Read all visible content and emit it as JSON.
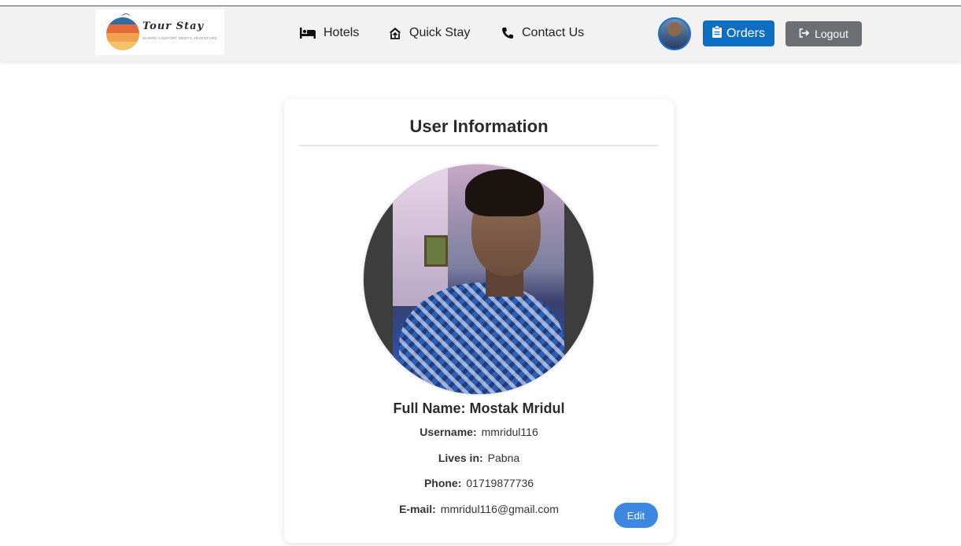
{
  "brand": {
    "name": "Tour Stay",
    "tagline": "WHERE COMFORT MEETS ADVENTURE"
  },
  "nav": {
    "links": [
      {
        "label": "Hotels",
        "icon": "bed-icon"
      },
      {
        "label": "Quick Stay",
        "icon": "house-up-icon"
      },
      {
        "label": "Contact Us",
        "icon": "phone-icon"
      }
    ],
    "orders_label": "Orders",
    "logout_label": "Logout"
  },
  "profile": {
    "title": "User Information",
    "full_name_label": "Full Name:",
    "full_name": "Mostak Mridul",
    "fields": [
      {
        "label": "Username:",
        "value": "mmridul116"
      },
      {
        "label": "Lives in:",
        "value": "Pabna"
      },
      {
        "label": "Phone:",
        "value": "01719877736"
      },
      {
        "label": "E-mail:",
        "value": "mmridul116@gmail.com"
      }
    ],
    "edit_label": "Edit"
  },
  "colors": {
    "primary": "#0d6fc4",
    "secondary": "#6b6e72",
    "edit": "#3d87e0",
    "navbar": "#f2f2f2"
  }
}
